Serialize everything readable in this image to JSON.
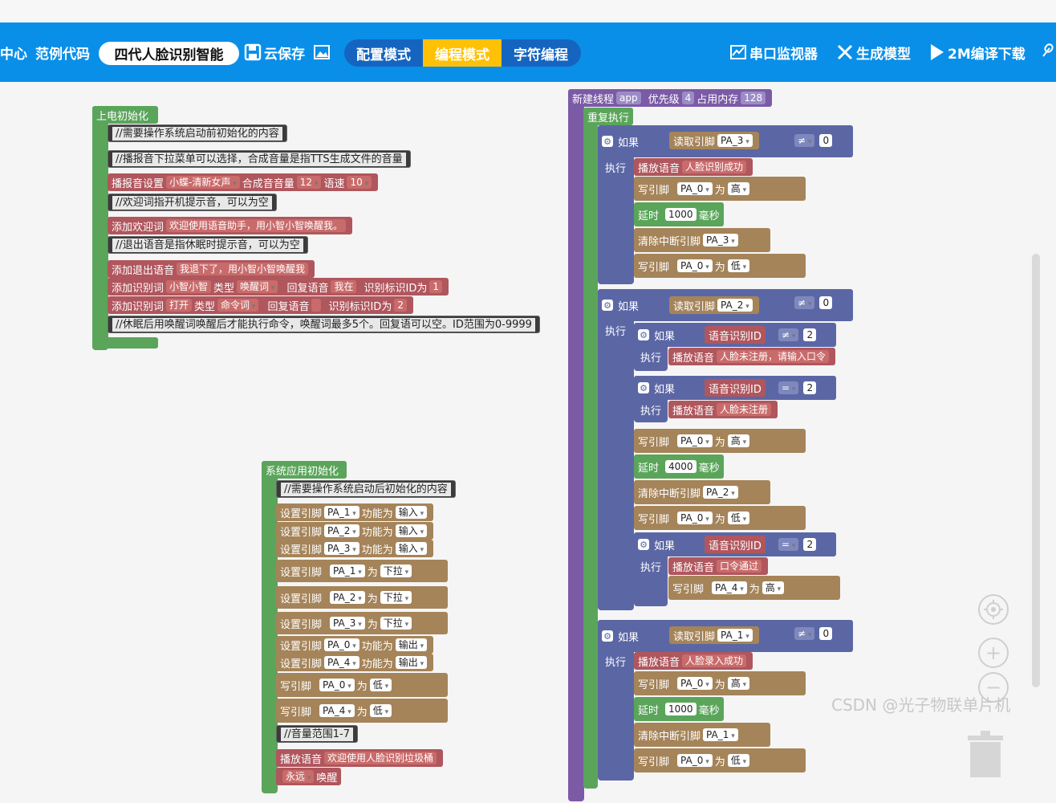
{
  "toolbar": {
    "left_cut": "中心",
    "examples": "范例代码",
    "project_name": "四代人脸识别智能",
    "save": "云保存",
    "mode_config": "配置模式",
    "mode_code": "编程模式",
    "mode_char": "字符编程",
    "serial": "串口监视器",
    "gen_model": "生成模型",
    "compile": "2M编译下载"
  },
  "init": {
    "hat": "上电初始化",
    "c1": "//需要操作系统启动前初始化的内容",
    "c2": "//播报音下拉菜单可以选择，合成音量是指TTS生成文件的音量",
    "voice_label": "播报音设置",
    "voice": "小蝶-清新女声",
    "vol_label": "合成音音量",
    "vol": "12",
    "speed_label": "语速",
    "speed": "10",
    "c3": "//欢迎词指开机提示音，可以为空",
    "welcome_label": "添加欢迎词",
    "welcome": "欢迎使用语音助手，用小智小智唤醒我。",
    "c4": "//退出语音是指休眠时提示音，可以为空",
    "exit_label": "添加退出语音",
    "exit": "我退下了，用小智小智唤醒我",
    "rec1_label": "添加识别词",
    "rec1": "小智小智",
    "type_label": "类型",
    "rec1_type": "唤醒词",
    "reply_label": "回复语音",
    "rec1_reply": "我在",
    "id_label": "识别标识ID为",
    "rec1_id": "1",
    "rec2_label": "添加识别词",
    "rec2": "打开",
    "rec2_type": "命令词",
    "rec2_reply": "",
    "rec2_id": "2",
    "c5": "//休眠后用唤醒词唤醒后才能执行命令，唤醒词最多5个。回复语可以空。ID范围为0-9999"
  },
  "sysinit": {
    "hat": "系统应用初始化",
    "c1": "//需要操作系统启动后初始化的内容",
    "set_pin": "设置引脚",
    "func": "功能为",
    "wei": "为",
    "write_pin": "写引脚",
    "pins_func": [
      [
        "PA_1",
        "输入"
      ],
      [
        "PA_2",
        "输入"
      ],
      [
        "PA_3",
        "输入"
      ]
    ],
    "pins_pull": [
      [
        "PA_1",
        "下拉"
      ],
      [
        "PA_2",
        "下拉"
      ],
      [
        "PA_3",
        "下拉"
      ]
    ],
    "pins_out": [
      [
        "PA_0",
        "输出"
      ],
      [
        "PA_4",
        "输出"
      ]
    ],
    "writes": [
      [
        "PA_0",
        "低"
      ],
      [
        "PA_4",
        "低"
      ]
    ],
    "c2": "//音量范围1-7",
    "play_label": "播放语音",
    "play": "欢迎使用人脸识别垃圾桶",
    "forever": "永远",
    "wake": "唤醒"
  },
  "thread": {
    "label": "新建线程",
    "name": "app",
    "prio_label": "优先级",
    "prio": "4",
    "mem_label": "占用内存",
    "mem": "128",
    "repeat": "重复执行",
    "if": "如果",
    "do": "执行",
    "read_pin": "读取引脚",
    "neq": "≠",
    "eq": "=",
    "play": "播放语音",
    "write_pin": "写引脚",
    "wei": "为",
    "delay": "延时",
    "ms": "毫秒",
    "clear_int": "清除中断引脚",
    "voice_id": "语音识别ID",
    "b1": {
      "pin": "PA_3",
      "val": "0",
      "say": "人脸识别成功",
      "w1": [
        "PA_0",
        "高"
      ],
      "delay": "1000",
      "clear": "PA_3",
      "w2": [
        "PA_0",
        "低"
      ]
    },
    "b2": {
      "pin": "PA_2",
      "val": "0",
      "id1": "2",
      "say1": "人脸未注册，请输入口令",
      "id2": "2",
      "say2": "人脸未注册",
      "w1": [
        "PA_0",
        "高"
      ],
      "delay": "4000",
      "clear": "PA_2",
      "w2": [
        "PA_0",
        "低"
      ],
      "id3": "2",
      "say3": "口令通过",
      "w3": [
        "PA_4",
        "高"
      ]
    },
    "b3": {
      "pin": "PA_1",
      "val": "0",
      "say": "人脸录入成功",
      "w1": [
        "PA_0",
        "高"
      ],
      "delay": "1000",
      "clear": "PA_1",
      "w2": [
        "PA_0",
        "低"
      ]
    }
  },
  "watermark": "CSDN @光子物联单片机"
}
